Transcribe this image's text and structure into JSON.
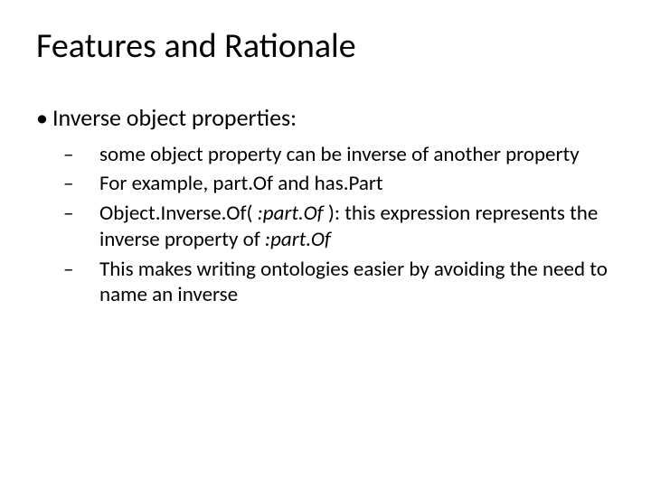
{
  "title": "Features and Rationale",
  "l1": {
    "text": "Inverse object properties:"
  },
  "s1": {
    "text": "some object property can be inverse of another property"
  },
  "s2": {
    "text": "For example, part.Of and has.Part"
  },
  "s3": {
    "pre": "Object.Inverse.Of( ",
    "arg": ":part.Of",
    "mid": " ): this expression represents the inverse property of ",
    "arg2": ":part.Of"
  },
  "s4": {
    "text": "This makes writing ontologies easier by avoiding the need to name an inverse"
  },
  "bullet": "•",
  "dash": "–"
}
